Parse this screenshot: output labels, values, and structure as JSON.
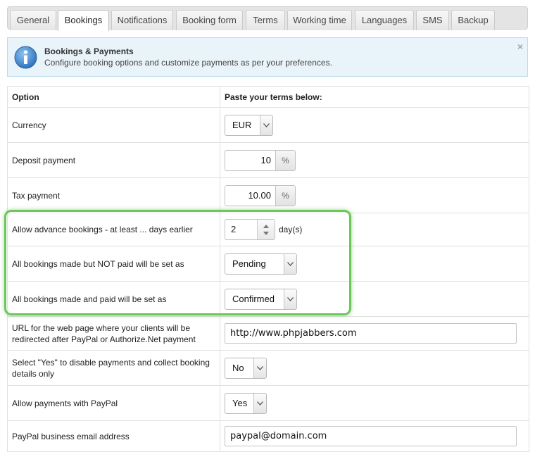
{
  "tabs": [
    {
      "label": "General",
      "active": false
    },
    {
      "label": "Bookings",
      "active": true
    },
    {
      "label": "Notifications",
      "active": false
    },
    {
      "label": "Booking form",
      "active": false
    },
    {
      "label": "Terms",
      "active": false
    },
    {
      "label": "Working time",
      "active": false
    },
    {
      "label": "Languages",
      "active": false
    },
    {
      "label": "SMS",
      "active": false
    },
    {
      "label": "Backup",
      "active": false
    }
  ],
  "notice": {
    "title": "Bookings & Payments",
    "text": "Configure booking options and customize payments as per your preferences.",
    "close": "×",
    "icon": "info-icon"
  },
  "table": {
    "header": {
      "option": "Option",
      "value": "Paste your terms below:"
    },
    "currency": {
      "label": "Currency",
      "value": "EUR"
    },
    "deposit": {
      "label": "Deposit payment",
      "value": "10",
      "unit": "%"
    },
    "tax": {
      "label": "Tax payment",
      "value": "10.00",
      "unit": "%"
    },
    "advance": {
      "label": "Allow advance bookings - at least ... days earlier",
      "value": "2",
      "unit": "day(s)"
    },
    "not_paid": {
      "label": "All bookings made but NOT paid will be set as",
      "value": "Pending"
    },
    "paid": {
      "label": "All bookings made and paid will be set as",
      "value": "Confirmed"
    },
    "url": {
      "label": "URL for the web page where your clients will be redirected after PayPal or Authorize.Net payment",
      "value": "http://www.phpjabbers.com"
    },
    "disable_payments": {
      "label": "Select \"Yes\" to disable payments and collect booking details only",
      "value": "No"
    },
    "paypal": {
      "label": "Allow payments with PayPal",
      "value": "Yes"
    },
    "paypal_email": {
      "label": "PayPal business email address",
      "value": "paypal@domain.com"
    }
  },
  "colors": {
    "highlight": "#6cc65a",
    "notice_bg": "#e9f4fa",
    "info_icon": "#3a7fc4"
  }
}
